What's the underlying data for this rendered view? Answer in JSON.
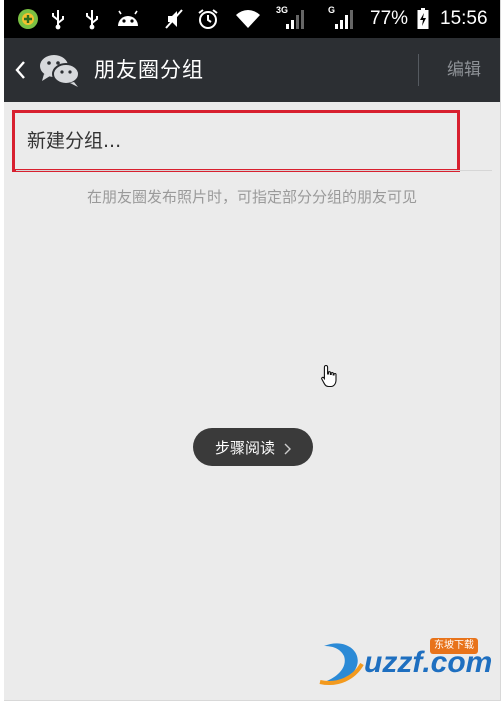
{
  "status_bar": {
    "network_3g": "3G",
    "network_g": "G",
    "battery_percent": "77%",
    "time": "15:56"
  },
  "action_bar": {
    "title": "朋友圈分组",
    "edit_label": "编辑"
  },
  "content": {
    "new_group_label": "新建分组...",
    "hint_text": "在朋友圈发布照片时，可指定部分分组的朋友可见"
  },
  "overlay": {
    "step_read_label": "步骤阅读"
  },
  "watermark": {
    "brand": "uzzf.com",
    "badge": "东坡下载"
  },
  "colors": {
    "status_bar_bg": "#000000",
    "action_bar_bg": "#2c2f33",
    "page_bg": "#ebebeb",
    "highlight_border": "#d8202f"
  }
}
